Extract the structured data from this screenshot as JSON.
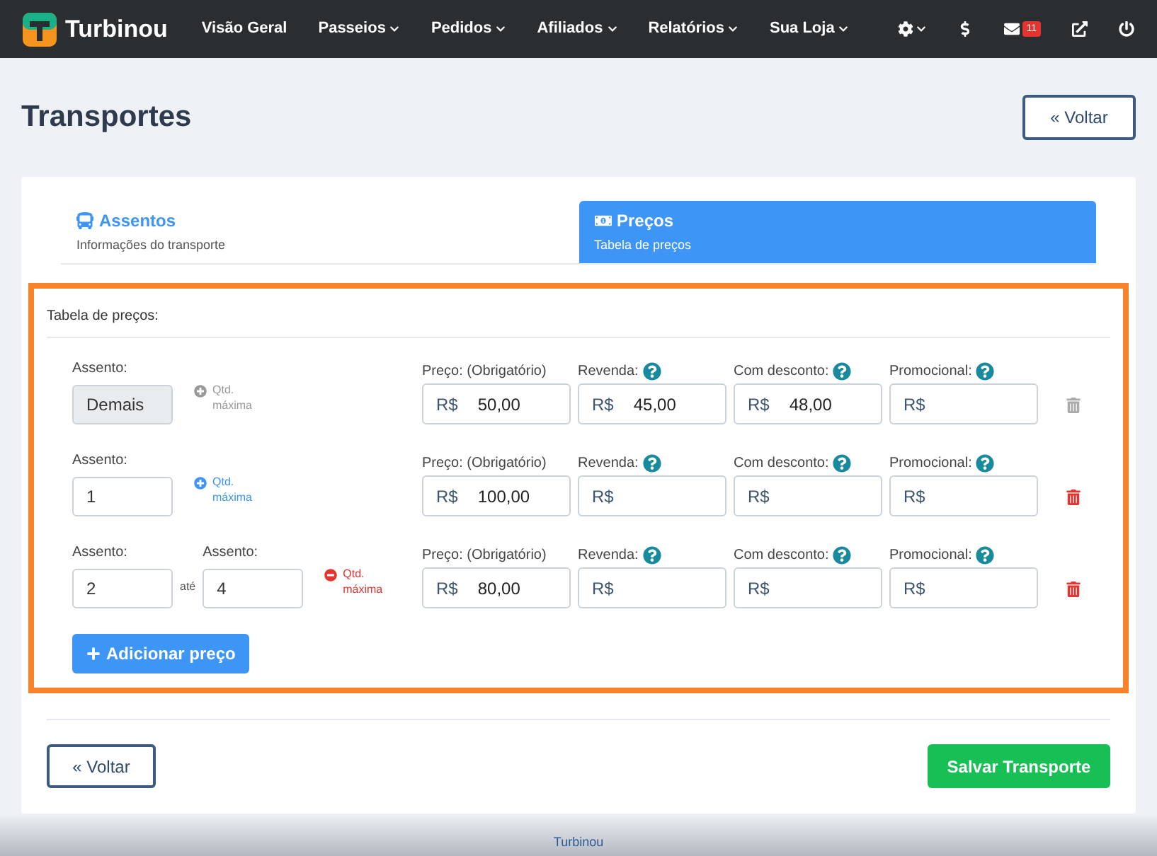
{
  "navbar": {
    "brand": "Turbinou",
    "items": [
      {
        "label": "Visão Geral",
        "dropdown": false
      },
      {
        "label": "Passeios",
        "dropdown": true
      },
      {
        "label": "Pedidos",
        "dropdown": true
      },
      {
        "label": "Afiliados",
        "dropdown": true
      },
      {
        "label": "Relatórios",
        "dropdown": true
      },
      {
        "label": "Sua Loja",
        "dropdown": true
      }
    ],
    "actions": [
      {
        "kind": "settings",
        "dropdown": true
      },
      {
        "kind": "dollar",
        "dropdown": false
      },
      {
        "kind": "mail",
        "dropdown": false,
        "badge": "11"
      },
      {
        "kind": "external",
        "dropdown": false
      },
      {
        "kind": "power",
        "dropdown": false
      }
    ]
  },
  "page": {
    "title": "Transportes",
    "back_button": "« Voltar"
  },
  "tabs": [
    {
      "kind": "bus",
      "title": "Assentos",
      "subtitle": "Informações do transporte",
      "selected": false
    },
    {
      "kind": "money",
      "title": "Preços",
      "subtitle": "Tabela de preços",
      "selected": true
    }
  ],
  "price_table": {
    "title": "Tabela de preços:",
    "rows": [
      {
        "seats": [
          {
            "label": "Assento:",
            "value": "Demais",
            "disabled": true
          }
        ],
        "qty": {
          "kind": "add",
          "label": "Qtd. máxima",
          "disabled": true
        },
        "prices": [
          {
            "label": "Preço: (Obrigatório)",
            "help": false,
            "prefix": "R$",
            "value": "50,00"
          },
          {
            "label": "Revenda:",
            "help": true,
            "prefix": "R$",
            "value": "45,00"
          },
          {
            "label": "Com desconto:",
            "help": true,
            "prefix": "R$",
            "value": "48,00"
          },
          {
            "label": "Promocional:",
            "help": true,
            "prefix": "R$"
          }
        ],
        "delete_disabled": true
      },
      {
        "seats": [
          {
            "label": "Assento:",
            "value": "1",
            "disabled": false
          }
        ],
        "qty": {
          "kind": "add",
          "label": "Qtd. máxima",
          "disabled": false
        },
        "prices": [
          {
            "label": "Preço: (Obrigatório)",
            "help": false,
            "prefix": "R$",
            "value": "100,00"
          },
          {
            "label": "Revenda:",
            "help": true,
            "prefix": "R$"
          },
          {
            "label": "Com desconto:",
            "help": true,
            "prefix": "R$"
          },
          {
            "label": "Promocional:",
            "help": true,
            "prefix": "R$"
          }
        ],
        "delete_disabled": false
      },
      {
        "seats": [
          {
            "label": "Assento:",
            "value": "2",
            "disabled": false
          },
          {
            "label": "Assento:",
            "value": "4",
            "disabled": false
          }
        ],
        "range_word": "até",
        "qty": {
          "kind": "remove",
          "label": "Qtd. máxima",
          "disabled": false
        },
        "prices": [
          {
            "label": "Preço: (Obrigatório)",
            "help": false,
            "prefix": "R$",
            "value": "80,00"
          },
          {
            "label": "Revenda:",
            "help": true,
            "prefix": "R$"
          },
          {
            "label": "Com desconto:",
            "help": true,
            "prefix": "R$"
          },
          {
            "label": "Promocional:",
            "help": true,
            "prefix": "R$"
          }
        ],
        "delete_disabled": false
      }
    ],
    "add_button": "Adicionar preço"
  },
  "footer": {
    "back_button": "« Voltar",
    "save_button": "Salvar Transporte",
    "credit": "Turbinou"
  }
}
